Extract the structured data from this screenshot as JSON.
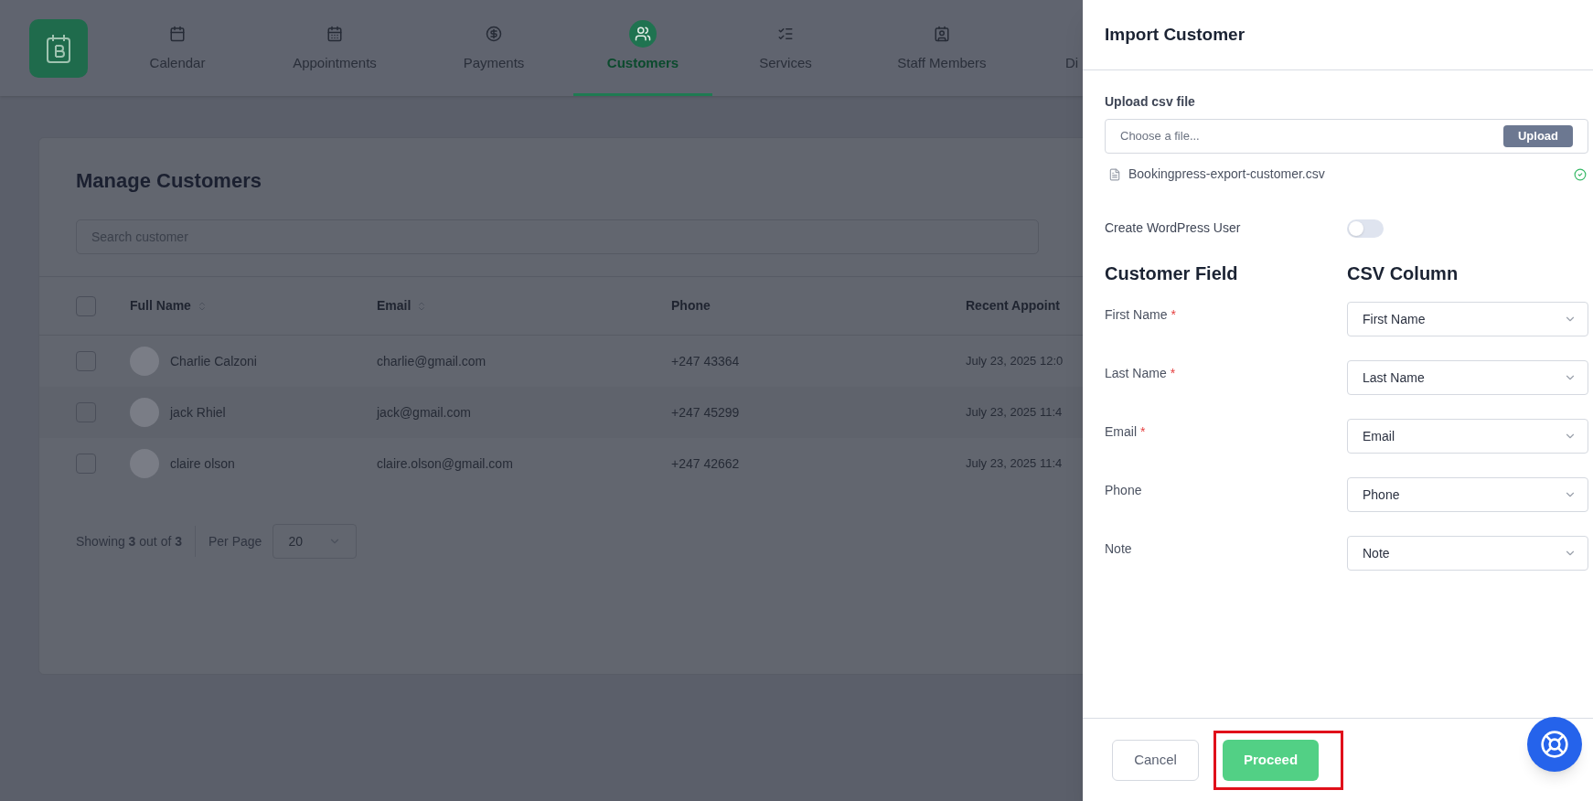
{
  "nav": {
    "items": [
      {
        "label": "Calendar",
        "selected": false
      },
      {
        "label": "Appointments",
        "selected": false
      },
      {
        "label": "Payments",
        "selected": false
      },
      {
        "label": "Customers",
        "selected": true
      },
      {
        "label": "Services",
        "selected": false
      },
      {
        "label": "Staff Members",
        "selected": false
      },
      {
        "label": "Di",
        "selected": false
      }
    ]
  },
  "customers": {
    "title": "Manage Customers",
    "search": {
      "placeholder": "Search customer"
    },
    "header_checkbox": {
      "checked": false
    },
    "columns": [
      {
        "label": "Full Name",
        "sortable": true
      },
      {
        "label": "Email",
        "sortable": true
      },
      {
        "label": "Phone",
        "sortable": false
      },
      {
        "label": "Recent Appoint",
        "sortable": false
      }
    ],
    "rows": [
      {
        "checked": false,
        "name": "Charlie Calzoni",
        "email": "charlie@gmail.com",
        "phone": "+247 43364",
        "recent": "July 23, 2025 12:0"
      },
      {
        "checked": false,
        "name": "jack Rhiel",
        "email": "jack@gmail.com",
        "phone": "+247 45299",
        "recent": "July 23, 2025 11:4"
      },
      {
        "checked": false,
        "name": "claire olson",
        "email": "claire.olson@gmail.com",
        "phone": "+247 42662",
        "recent": "July 23, 2025 11:4"
      }
    ],
    "pagination": {
      "summary": "Showing **3** out of **3**",
      "per_page_label": "Per Page",
      "per_page": "20"
    }
  },
  "drawer": {
    "title": "Import Customer",
    "upload_label": "Upload csv file",
    "file_placeholder": "Choose a file...",
    "upload_button": "Upload",
    "file": {
      "name": "Bookingpress-export-customer.csv",
      "uploaded": true
    },
    "toggle": {
      "label": "Create WordPress User",
      "on": false
    },
    "field_header": "Customer Field",
    "column_header": "CSV Column",
    "mappings": [
      {
        "field": "First Name",
        "required_mark": "*",
        "column": "First Name"
      },
      {
        "field": "Last Name",
        "required_mark": "*",
        "column": "Last Name"
      },
      {
        "field": "Email",
        "required_mark": "*",
        "column": "Email"
      },
      {
        "field": "Phone",
        "column": "Phone"
      },
      {
        "field": "Note",
        "column": "Note"
      }
    ],
    "cancel": "Cancel",
    "proceed": {
      "label": "Proceed",
      "highlighted": true
    }
  }
}
